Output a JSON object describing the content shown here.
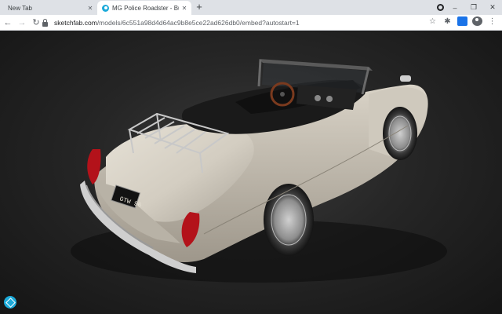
{
  "browser": {
    "tabs": [
      {
        "title": "New Tab",
        "active": false
      },
      {
        "title": "MG Police Roadster - Buy Ro",
        "active": true
      }
    ],
    "new_tab_symbol": "+",
    "window_controls": {
      "minimize": "–",
      "restore": "❐",
      "close": "✕"
    },
    "url_host": "sketchfab.com",
    "url_rest": "/models/6c551a98d4d64ac9b8e5ce22ad626db0/embed?autostart=1"
  },
  "toolbar_icons": [
    "back-icon",
    "forward-icon",
    "reload-icon",
    "star-icon",
    "extensions-icon",
    "profile-icon",
    "menu-icon"
  ],
  "viewer": {
    "plate_text": "GTW 96",
    "background_color": "#262626",
    "car_color": "#d8d2c6",
    "brand_color": "#1caad9"
  }
}
